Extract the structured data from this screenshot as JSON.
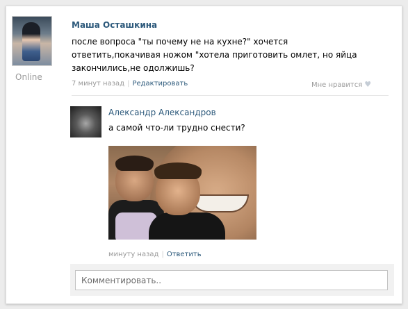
{
  "post": {
    "author": "Маша Осташкина",
    "status": "Online",
    "text": "после вопроса \"ты почему не на кухне?\" хочется ответить,покачивая ножом \"хотела приготовить омлет, но яйца закончились,не одолжишь?",
    "time": "7 минут назад",
    "separator": "|",
    "edit_label": "Редактировать",
    "like_label": "Мне нравится",
    "like_icon": "heart-icon"
  },
  "reply": {
    "author": "Александр Александров",
    "text": "а самой что-ли трудно снести?",
    "time": "минуту назад",
    "separator": "|",
    "answer_label": "Ответить"
  },
  "comment": {
    "placeholder": "Комментировать.."
  },
  "colors": {
    "link": "#2b587a",
    "meta": "#999999",
    "background": "#ececec"
  }
}
